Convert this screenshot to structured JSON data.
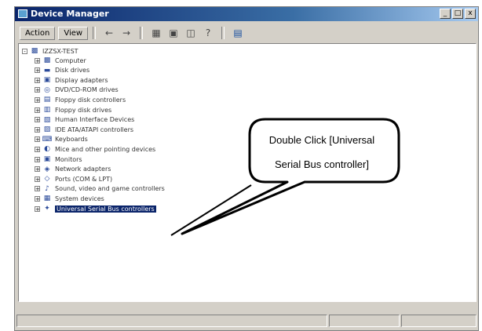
{
  "window": {
    "title": "Device Manager",
    "controls": [
      "_",
      "□",
      "x"
    ]
  },
  "menu": {
    "action": "Action",
    "view": "View",
    "toolbar_icons": [
      "back-icon",
      "forward-icon",
      "list-icon",
      "properties-icon",
      "refresh-icon",
      "help-icon",
      "scan-icon"
    ]
  },
  "tree": {
    "root": "IZZSX-TEST",
    "items": [
      {
        "label": "Computer",
        "icon": "computer-icon"
      },
      {
        "label": "Disk drives",
        "icon": "disk-icon"
      },
      {
        "label": "Display adapters",
        "icon": "monitor-icon"
      },
      {
        "label": "DVD/CD-ROM drives",
        "icon": "cdrom-icon"
      },
      {
        "label": "Floppy disk controllers",
        "icon": "floppy-controller-icon"
      },
      {
        "label": "Floppy disk drives",
        "icon": "floppy-icon"
      },
      {
        "label": "Human Interface Devices",
        "icon": "hid-icon"
      },
      {
        "label": "IDE ATA/ATAPI controllers",
        "icon": "ide-icon"
      },
      {
        "label": "Keyboards",
        "icon": "keyboard-icon"
      },
      {
        "label": "Mice and other pointing devices",
        "icon": "mouse-icon"
      },
      {
        "label": "Monitors",
        "icon": "monitor-icon"
      },
      {
        "label": "Network adapters",
        "icon": "network-icon"
      },
      {
        "label": "Ports (COM & LPT)",
        "icon": "port-icon"
      },
      {
        "label": "Sound, video and game controllers",
        "icon": "sound-icon"
      },
      {
        "label": "System devices",
        "icon": "system-icon"
      },
      {
        "label": "Universal Serial Bus controllers",
        "icon": "usb-icon",
        "selected": true
      }
    ]
  },
  "callout": {
    "line1": "Double Click [Universal",
    "line2": "Serial Bus controller]"
  }
}
